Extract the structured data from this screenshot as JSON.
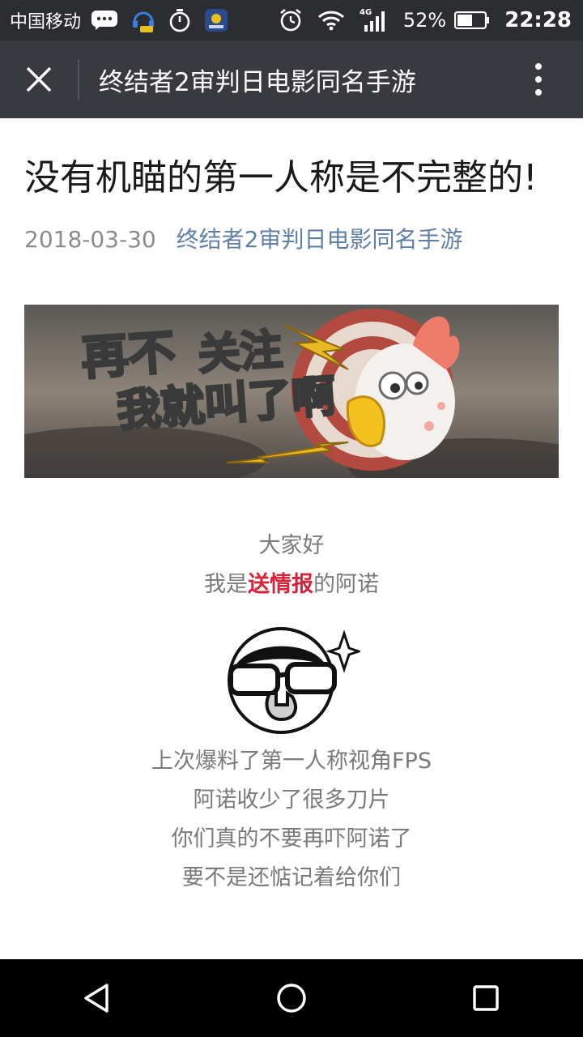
{
  "status_bar": {
    "carrier": "中国移动",
    "network": "4G",
    "battery": "52%",
    "time": "22:28"
  },
  "title_bar": {
    "title": "终结者2审判日电影同名手游"
  },
  "article": {
    "title": "没有机瞄的第一人称是不完整的!",
    "date": "2018-03-30",
    "account": "终结者2审判日电影同名手游",
    "banner": {
      "line1_a": "再不",
      "line1_b": "关注",
      "line2": "我就叫了啊"
    },
    "greeting": "大家好",
    "intro": {
      "pre": "我是",
      "highlight": "送情报",
      "post": "的阿诺"
    },
    "body_lines": [
      "上次爆料了第一人称视角FPS",
      "阿诺收少了很多刀片",
      "你们真的不要再吓阿诺了",
      "要不是还惦记着给你们"
    ]
  },
  "colors": {
    "title_bar_bg": "#393a3f",
    "status_bar_bg": "#2c2d31",
    "link": "#607fa6",
    "highlight": "#d4233a"
  },
  "icons": {
    "close": "close-icon",
    "more": "more-vertical-icon",
    "back": "back-triangle-icon",
    "home": "home-circle-icon",
    "recent": "recent-square-icon"
  }
}
